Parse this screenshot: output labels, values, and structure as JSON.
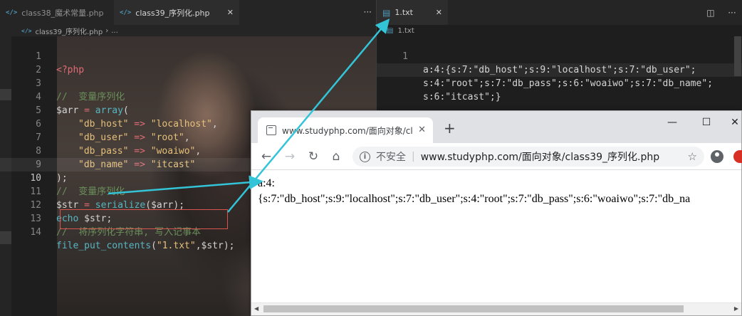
{
  "left_editor": {
    "tabs": [
      {
        "icon": "php-icon",
        "label": "class38_魔术常量.php"
      },
      {
        "icon": "php-icon",
        "label": "class39_序列化.php"
      }
    ],
    "more_label": "···",
    "breadcrumb": {
      "file": "class39_序列化.php",
      "sep": "›",
      "tail": "..."
    },
    "current_line": 10,
    "lines": [
      {
        "n": "1"
      },
      {
        "n": "2"
      },
      {
        "n": "3"
      },
      {
        "n": "4"
      },
      {
        "n": "5"
      },
      {
        "n": "6"
      },
      {
        "n": "7"
      },
      {
        "n": "8"
      },
      {
        "n": "9"
      },
      {
        "n": "10"
      },
      {
        "n": "11"
      },
      {
        "n": "12"
      },
      {
        "n": "13"
      },
      {
        "n": "14"
      }
    ],
    "code": {
      "l1": "<?php",
      "l3": "//  变量序列化",
      "l4_var": "$arr",
      "l4_op": " = ",
      "l4_fn": "array",
      "l4_rest": "(",
      "l5_key": "\"db_host\"",
      "l5_op": " => ",
      "l5_val": "\"localhost\"",
      "l6_key": "\"db_user\"",
      "l6_op": " => ",
      "l6_val": "\"root\"",
      "l7_key": "\"db_pass\"",
      "l7_op": " => ",
      "l7_val": "\"woaiwo\"",
      "l8_key": "\"db_name\"",
      "l8_op": " => ",
      "l8_val": "\"itcast\"",
      "l9": ");",
      "l10": "//  变量序列化",
      "l11_var": "$str",
      "l11_op": " = ",
      "l11_fn": "serialize",
      "l11_rest": "($arr);",
      "l12_kw": "echo",
      "l12_rest": " $str;",
      "l13": "//  将序列化字符串, 写入记事本",
      "l14_fn": "file_put_contents",
      "l14_a": "(",
      "l14_str": "\"1.txt\"",
      "l14_b": ",$str);",
      "comma": ","
    }
  },
  "right_editor": {
    "tab": {
      "icon": "file-text-icon",
      "label": "1.txt"
    },
    "breadcrumb": {
      "file": "1.txt"
    },
    "actions": [
      "split-editor-icon",
      "more-icon"
    ],
    "lines": [
      {
        "n": "1",
        "text": "a:4:{s:7:\"db_host\";s:9:\"localhost\";s:7:\"db_user\";"
      },
      {
        "n": "",
        "text": "s:4:\"root\";s:7:\"db_pass\";s:6:\"woaiwo\";s:7:\"db_name\";"
      },
      {
        "n": "",
        "text": "s:6:\"itcast\";}"
      }
    ]
  },
  "browser": {
    "tab_title": "www.studyphp.com/面向对象/cl",
    "new_tab": "+",
    "window_controls": {
      "minimize": "—",
      "maximize": "☐",
      "close": "✕"
    },
    "insecure_label": "不安全",
    "separator": "|",
    "url": "www.studyphp.com/面向对象/class39_序列化.php",
    "page_line1": "a:4:",
    "page_line2": "{s:7:\"db_host\";s:9:\"localhost\";s:7:\"db_user\";s:4:\"root\";s:7:\"db_pass\";s:6:\"woaiwo\";s:7:\"db_na"
  },
  "colors": {
    "arrow": "#33c4d8",
    "annotation_box": "#d9534f"
  }
}
